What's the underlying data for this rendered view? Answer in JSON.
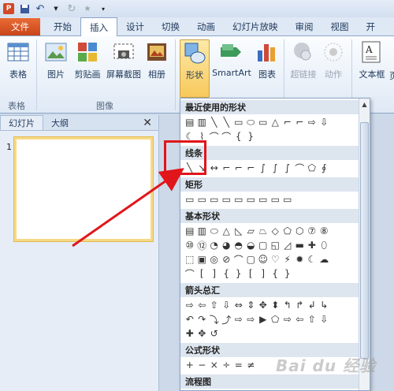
{
  "titlebar": {
    "icons": [
      "powerpoint-logo",
      "save-icon",
      "undo-icon",
      "redo-icon",
      "star-icon",
      "customize-icon"
    ]
  },
  "tabs": [
    {
      "label": "文件",
      "name": "tab-file"
    },
    {
      "label": "开始",
      "name": "tab-home"
    },
    {
      "label": "插入",
      "name": "tab-insert"
    },
    {
      "label": "设计",
      "name": "tab-design"
    },
    {
      "label": "切换",
      "name": "tab-transitions"
    },
    {
      "label": "动画",
      "name": "tab-animations"
    },
    {
      "label": "幻灯片放映",
      "name": "tab-slideshow"
    },
    {
      "label": "审阅",
      "name": "tab-review"
    },
    {
      "label": "视图",
      "name": "tab-view"
    },
    {
      "label": "开",
      "name": "tab-developer"
    }
  ],
  "ribbon": {
    "table_label": "表格",
    "image_label": "图片",
    "clipart_label": "剪贴画",
    "screenshot_label": "屏幕截图",
    "album_label": "相册",
    "shapes_label": "形状",
    "smartart_label": "SmartArt",
    "chart_label": "图表",
    "hyperlink_label": "超链接",
    "action_label": "动作",
    "textbox_label": "文本框",
    "textbox_trunc": "页",
    "group_table": "表格",
    "group_image": "图像"
  },
  "left_panel": {
    "tab_slides": "幻灯片",
    "tab_outline": "大纲",
    "close": "✕",
    "slide_number": "1"
  },
  "gallery": {
    "sec_recent": "最近使用的形状",
    "sec_lines": "线条",
    "sec_rect": "矩形",
    "sec_basic": "基本形状",
    "sec_arrows": "箭头总汇",
    "sec_formula": "公式形状",
    "sec_flowchart": "流程图",
    "recent_row1": [
      "▤",
      "▥",
      "╲",
      "╲",
      "▭",
      "⬭",
      "▭",
      "△",
      "⌐",
      "⌐",
      "⇨",
      "⇩"
    ],
    "recent_row2": [
      "☾",
      "⌇",
      "⌒",
      "⌒",
      "{",
      "}"
    ],
    "lines_row": [
      "╲",
      "↘",
      "↔",
      "⌐",
      "⌐",
      "⌐",
      "∫",
      "∫",
      "∫",
      "⌒",
      "⬠",
      "∮"
    ],
    "rect_row": [
      "▭",
      "▭",
      "▭",
      "▭",
      "▭",
      "▭",
      "▭",
      "▭",
      "▭"
    ],
    "basic_row1": [
      "▤",
      "▥",
      "⬭",
      "△",
      "◺",
      "▱",
      "⏢",
      "◇",
      "⬠",
      "⬡",
      "⑦",
      "⑧"
    ],
    "basic_row2": [
      "⑩",
      "⑫",
      "◔",
      "◕",
      "◓",
      "◒",
      "▢",
      "◱",
      "◿",
      "▬",
      "✚",
      "⬯"
    ],
    "basic_row3": [
      "⬚",
      "▣",
      "◎",
      "⊘",
      "⌒",
      "▢",
      "☺",
      "♡",
      "⚡",
      "✹",
      "☾",
      "☁"
    ],
    "basic_row4": [
      "⌒",
      "[",
      "]",
      "{",
      "}",
      "[",
      "]",
      "{",
      "}"
    ],
    "arrows_row1": [
      "⇨",
      "⇦",
      "⇧",
      "⇩",
      "⇔",
      "⇕",
      "✥",
      "⬍",
      "↰",
      "↱",
      "↲",
      "↳"
    ],
    "arrows_row2": [
      "↶",
      "↷",
      "⤵",
      "⤴",
      "⇨",
      "⇨",
      "▶",
      "⬠",
      "⇨",
      "⇦",
      "⇧",
      "⇩"
    ],
    "arrows_row3": [
      "✚",
      "✥",
      "↺"
    ],
    "formula_row": [
      "+",
      "−",
      "×",
      "÷",
      "=",
      "≠"
    ]
  },
  "watermark": "Bai du 经验"
}
